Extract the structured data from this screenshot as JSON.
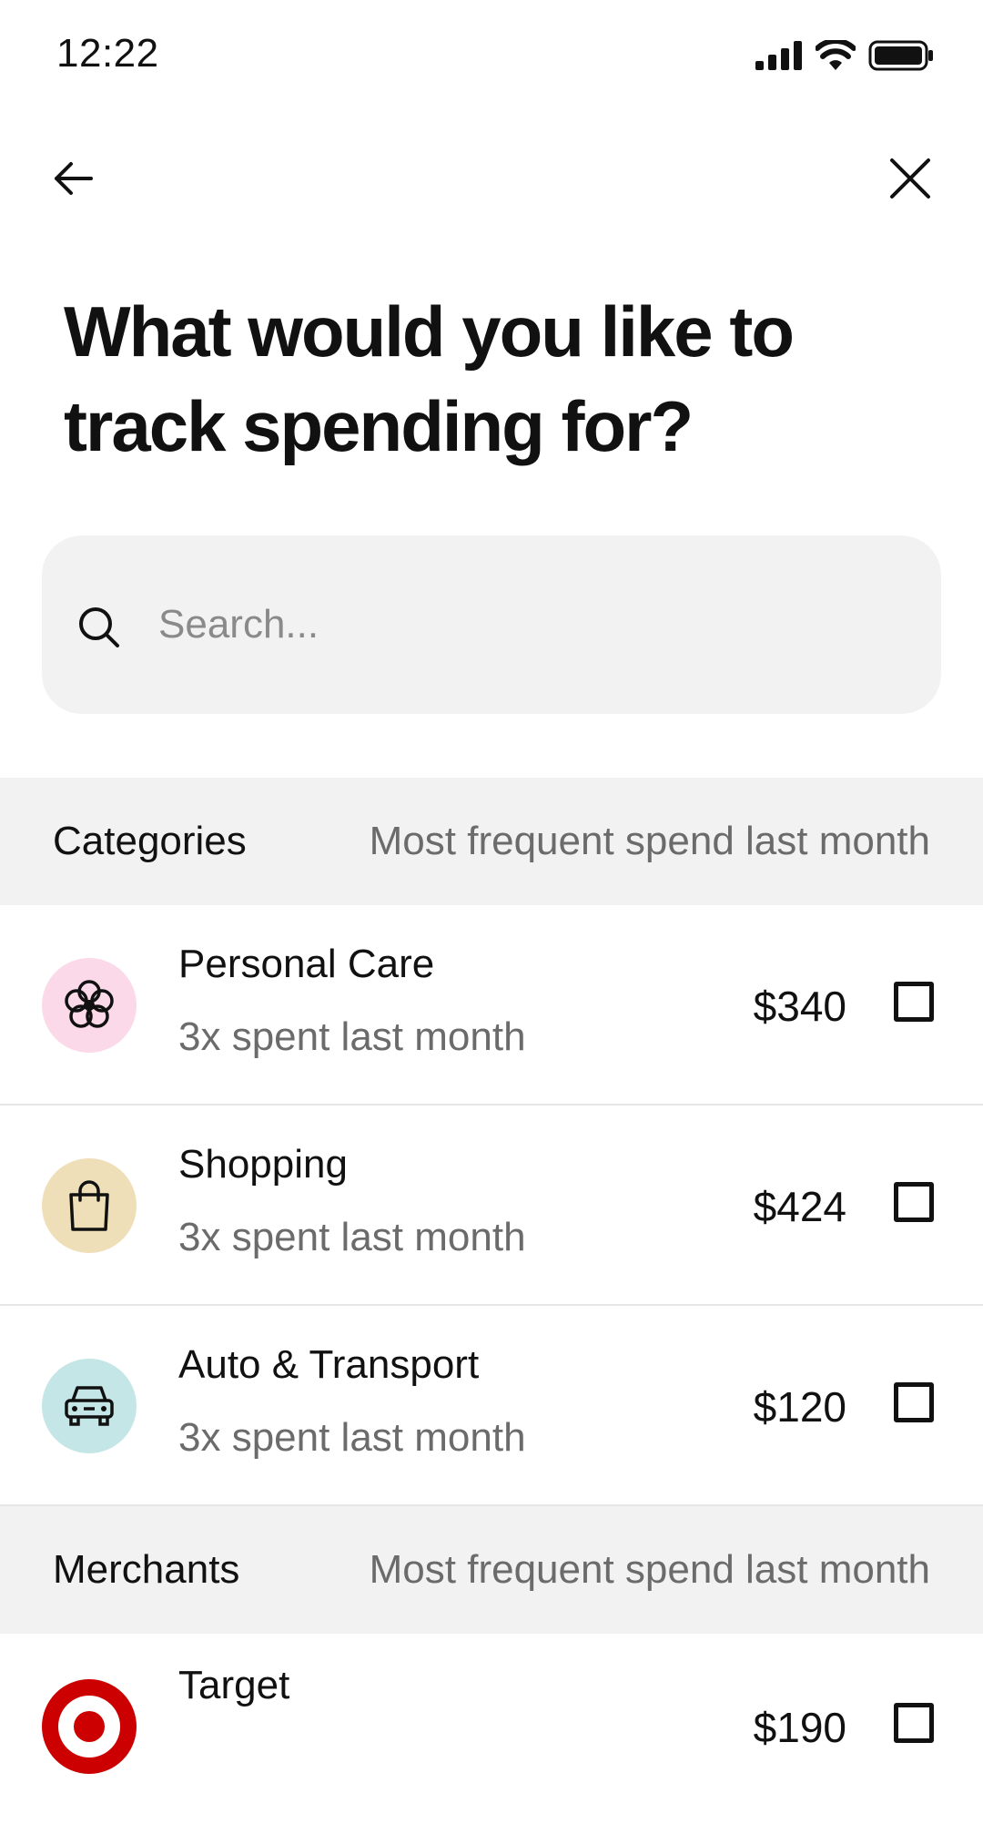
{
  "status_bar": {
    "time": "12:22"
  },
  "page": {
    "title": "What would you like to track spending for?"
  },
  "search": {
    "placeholder": "Search..."
  },
  "sections": {
    "categories": {
      "title": "Categories",
      "subtitle": "Most frequent spend last month",
      "items": [
        {
          "name": "Personal Care",
          "detail": "3x spent last month",
          "amount": "$340",
          "icon": "flower-icon",
          "icon_bg": "#fbd9e8",
          "checked": false
        },
        {
          "name": "Shopping",
          "detail": "3x spent last month",
          "amount": "$424",
          "icon": "shopping-bag-icon",
          "icon_bg": "#efdfb8",
          "checked": false
        },
        {
          "name": "Auto & Transport",
          "detail": "3x spent last month",
          "amount": "$120",
          "icon": "car-icon",
          "icon_bg": "#c5e6e6",
          "checked": false
        }
      ]
    },
    "merchants": {
      "title": "Merchants",
      "subtitle": "Most frequent spend last month",
      "items": [
        {
          "name": "Target",
          "detail": "",
          "amount": "$190",
          "icon": "target-logo-icon",
          "icon_bg": "#cc0000",
          "checked": false
        }
      ]
    }
  }
}
